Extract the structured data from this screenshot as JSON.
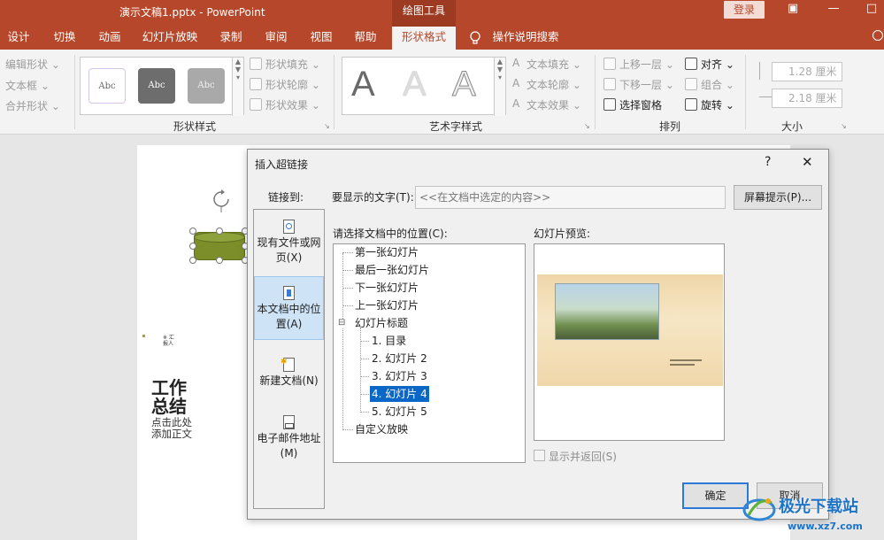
{
  "titlebar": {
    "document_title": "演示文稿1.pptx  -  PowerPoint",
    "context_tab_group": "绘图工具",
    "login": "登录"
  },
  "tabs": [
    {
      "label": "设计"
    },
    {
      "label": "切换"
    },
    {
      "label": "动画"
    },
    {
      "label": "幻灯片放映"
    },
    {
      "label": "录制"
    },
    {
      "label": "审阅"
    },
    {
      "label": "视图"
    },
    {
      "label": "帮助"
    },
    {
      "label": "形状格式",
      "active": true
    },
    {
      "label": "操作说明搜索"
    }
  ],
  "ribbon": {
    "insert_shapes": {
      "edit_shape": "编辑形状 ⌄",
      "text_box": "文本框 ⌄",
      "merge_shapes": "合并形状 ⌄"
    },
    "shape_styles": {
      "label": "形状样式",
      "style_samples": [
        "Abc",
        "Abc",
        "Abc"
      ],
      "fill": "形状填充 ⌄",
      "outline": "形状轮廓 ⌄",
      "effects": "形状效果 ⌄"
    },
    "wordart_styles": {
      "label": "艺术字样式",
      "samples": [
        "A",
        "A",
        "A"
      ],
      "text_fill": "文本填充 ⌄",
      "text_outline": "文本轮廓 ⌄",
      "text_effects": "文本效果 ⌄"
    },
    "arrange": {
      "label": "排列",
      "bring_forward": "上移一层 ⌄",
      "send_backward": "下移一层 ⌄",
      "selection_pane": "选择窗格",
      "align": "对齐 ⌄",
      "group": "组合 ⌄",
      "rotate": "旋转 ⌄"
    },
    "size": {
      "label": "大小",
      "height": "1.28 厘米",
      "width": "2.18 厘米"
    }
  },
  "slide": {
    "title_text": "工作总结",
    "subtitle_text": "点击此处添加正文",
    "small_text": "※ 汇报人"
  },
  "dialog": {
    "title": "插入超链接",
    "help": "?",
    "close": "✕",
    "link_to_label": "链接到:",
    "link_options": [
      {
        "label": "现有文件或网页(X)"
      },
      {
        "label": "本文档中的位置(A)",
        "selected": true
      },
      {
        "label": "新建文档(N)"
      },
      {
        "label": "电子邮件地址(M)"
      }
    ],
    "text_to_display_label": "要显示的文字(T):",
    "text_to_display_value": "<<在文档中选定的内容>>",
    "screentip_button": "屏幕提示(P)...",
    "place_label": "请选择文档中的位置(C):",
    "tree": [
      {
        "label": "第一张幻灯片",
        "level": 0
      },
      {
        "label": "最后一张幻灯片",
        "level": 0
      },
      {
        "label": "下一张幻灯片",
        "level": 0
      },
      {
        "label": "上一张幻灯片",
        "level": 0
      },
      {
        "label": "幻灯片标题",
        "level": 0,
        "expander": "⊟"
      },
      {
        "label": "1. 目录",
        "level": 1
      },
      {
        "label": "2. 幻灯片 2",
        "level": 1
      },
      {
        "label": "3. 幻灯片 3",
        "level": 1
      },
      {
        "label": "4. 幻灯片 4",
        "level": 1,
        "selected": true
      },
      {
        "label": "5. 幻灯片 5",
        "level": 1
      },
      {
        "label": "自定义放映",
        "level": 0
      }
    ],
    "preview_label": "幻灯片预览:",
    "show_and_return": "显示并返回(S)",
    "ok": "确定",
    "cancel": "取消"
  },
  "watermark": {
    "text": "极光下载站",
    "url": "www.xz7.com"
  }
}
